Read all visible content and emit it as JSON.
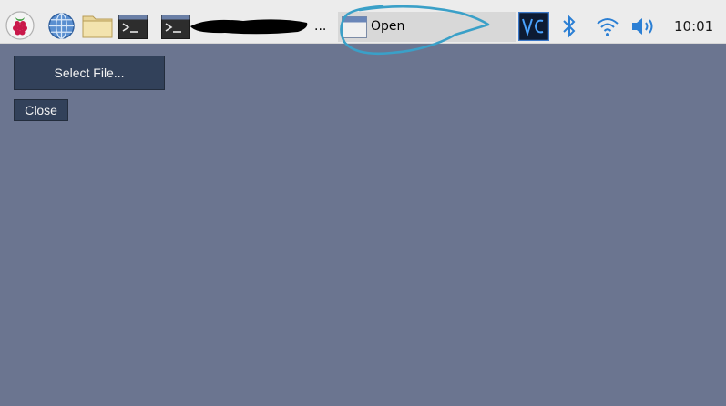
{
  "taskbar": {
    "launchers": [
      {
        "name": "raspberry-menu-icon"
      },
      {
        "name": "web-browser-icon"
      },
      {
        "name": "file-manager-icon"
      },
      {
        "name": "terminal-icon"
      }
    ],
    "task_buttons": [
      {
        "label": "",
        "icon": "terminal-icon",
        "redacted": true,
        "trailing": "..."
      },
      {
        "label": "Open",
        "icon": "window-icon",
        "active": true
      }
    ],
    "tray": [
      {
        "name": "vnc-icon"
      },
      {
        "name": "bluetooth-icon"
      },
      {
        "name": "wifi-icon"
      },
      {
        "name": "volume-icon"
      }
    ],
    "clock": "10:01"
  },
  "app": {
    "select_file_label": "Select File...",
    "close_label": "Close"
  },
  "colors": {
    "desktop": "#6b7590",
    "button": "#32415a",
    "taskbar": "#ececec",
    "annotation": "#3aa0c8",
    "accent": "#2b7fd4"
  }
}
